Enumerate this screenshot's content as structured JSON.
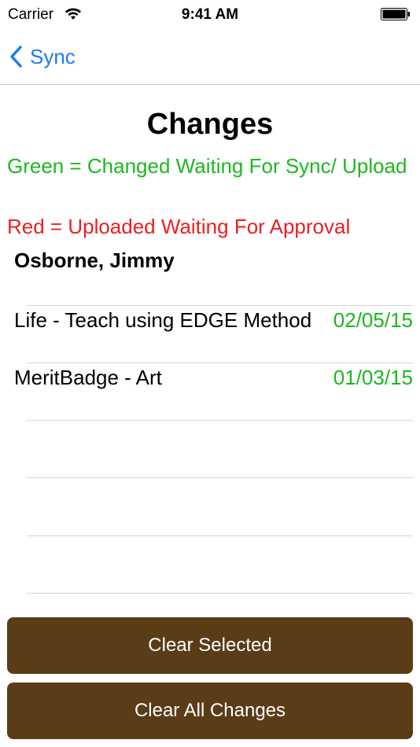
{
  "status_bar": {
    "carrier": "Carrier",
    "time": "9:41 AM"
  },
  "nav": {
    "back_label": "Sync"
  },
  "page": {
    "title": "Changes",
    "legend_green": "Green = Changed Waiting For Sync/ Upload",
    "legend_red": "Red = Uploaded Waiting For Approval",
    "scout_name": "Osborne, Jimmy"
  },
  "changes": [
    {
      "label": "Life - Teach using EDGE Method",
      "date": "02/05/15",
      "status": "green"
    },
    {
      "label": "MeritBadge - Art",
      "date": "01/03/15",
      "status": "green"
    }
  ],
  "buttons": {
    "clear_selected": "Clear Selected",
    "clear_all": "Clear All Changes"
  },
  "colors": {
    "accent": "#1a7cf5",
    "green": "#1cb81f",
    "red": "#ec1f1f",
    "button_bg": "#5a3c17"
  }
}
